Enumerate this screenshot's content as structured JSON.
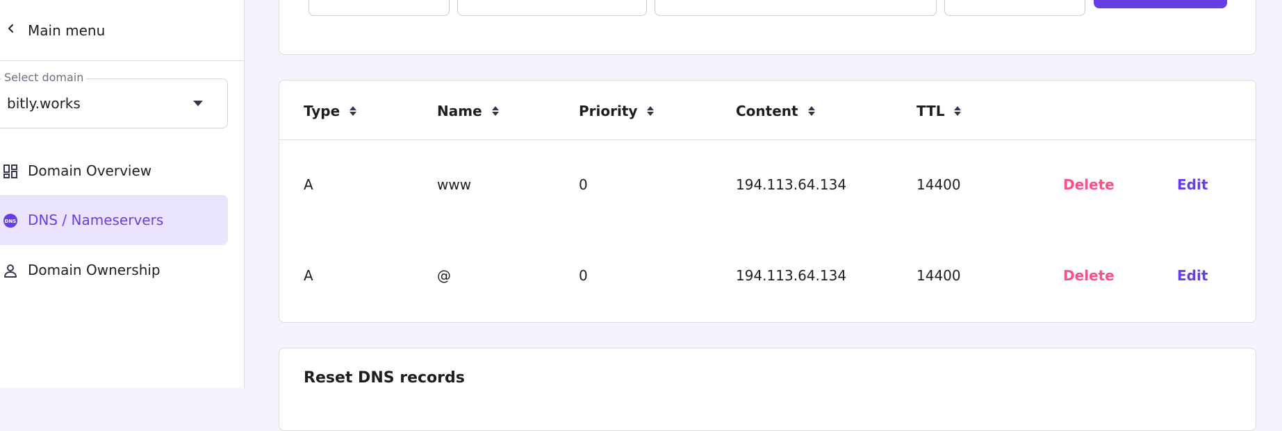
{
  "sidebar": {
    "back_label": "Main menu",
    "select_domain": {
      "legend": "Select domain",
      "value": "bitly.works"
    },
    "nav": [
      {
        "label": "Domain Overview",
        "icon": "grid-icon"
      },
      {
        "label": "DNS / Nameservers",
        "icon": "dns-icon",
        "active": true
      },
      {
        "label": "Domain Ownership",
        "icon": "person-icon"
      }
    ]
  },
  "dns_table": {
    "columns": [
      "Type",
      "Name",
      "Priority",
      "Content",
      "TTL"
    ],
    "rows": [
      {
        "type": "A",
        "name": "www",
        "priority": "0",
        "content": "194.113.64.134",
        "ttl": "14400",
        "delete_label": "Delete",
        "edit_label": "Edit"
      },
      {
        "type": "A",
        "name": "@",
        "priority": "0",
        "content": "194.113.64.134",
        "ttl": "14400",
        "delete_label": "Delete",
        "edit_label": "Edit"
      }
    ]
  },
  "reset_section": {
    "title": "Reset DNS records"
  },
  "colors": {
    "accent": "#673de6",
    "delete": "#fc5185",
    "active_bg": "#ebe4ff",
    "page_bg": "#f4f4fc"
  }
}
